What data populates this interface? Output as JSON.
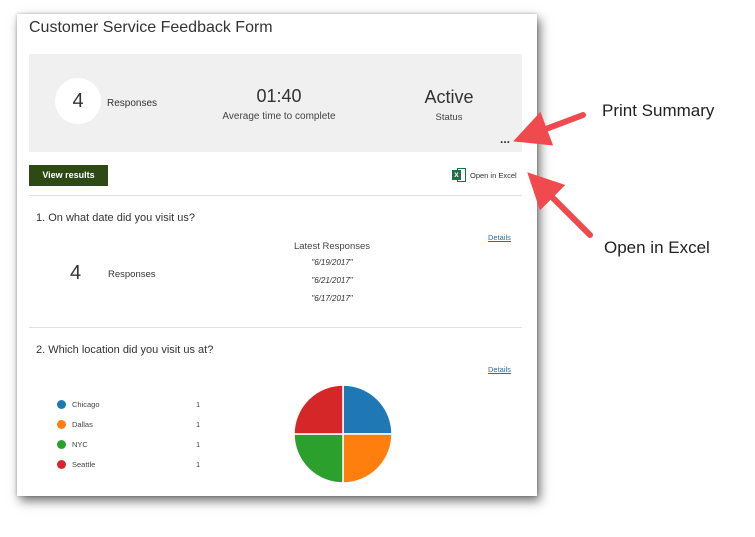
{
  "form": {
    "title": "Customer Service Feedback Form"
  },
  "summary": {
    "responses_count": "4",
    "responses_label": "Responses",
    "avg_time": "01:40",
    "avg_time_label": "Average time to complete",
    "status": "Active",
    "status_label": "Status",
    "more_label": "..."
  },
  "toolbar": {
    "view_results_label": "View results",
    "open_excel_label": "Open in Excel",
    "excel_icon": "excel-icon"
  },
  "questions": [
    {
      "title": "1.  On what date did you visit us?",
      "details_label": "Details",
      "responses_count": "4",
      "responses_label": "Responses",
      "latest_title": "Latest Responses",
      "latest": [
        "\"6/19/2017\"",
        "\"6/21/2017\"",
        "\"6/17/2017\""
      ]
    },
    {
      "title": "2.  Which location did you visit us at?",
      "details_label": "Details",
      "options": [
        {
          "name": "Chicago",
          "count": "1",
          "color": "#1f77b4"
        },
        {
          "name": "Dallas",
          "count": "1",
          "color": "#ff7f0e"
        },
        {
          "name": "NYC",
          "count": "1",
          "color": "#2ca02c"
        },
        {
          "name": "Seattle",
          "count": "1",
          "color": "#d62728"
        }
      ],
      "pie": {
        "values": [
          1,
          1,
          1,
          1
        ],
        "colors": [
          "#1f77b4",
          "#ff7f0e",
          "#2ca02c",
          "#d62728"
        ]
      }
    }
  ],
  "annotations": {
    "print_summary": "Print Summary",
    "open_in_excel": "Open in Excel",
    "arrow_color": "#f04a4f"
  }
}
